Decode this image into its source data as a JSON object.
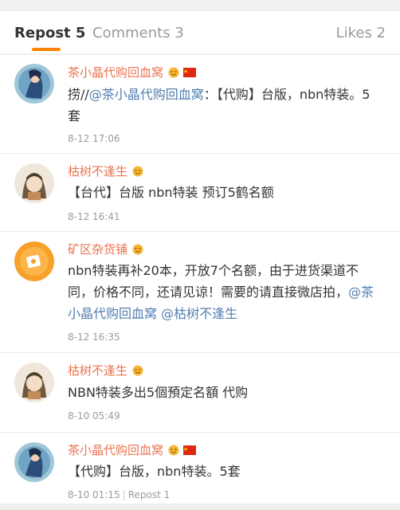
{
  "tabs": {
    "repost": "Repost 5",
    "comments": "Comments 3",
    "likes": "Likes 2"
  },
  "colors": {
    "accent": "#ff8200",
    "username": "#eb7350",
    "mention": "#507daf"
  },
  "items": [
    {
      "user": "茶小晶代购回血窝",
      "badges": [
        "vip-face-icon",
        "china-flag-icon"
      ],
      "text_parts": [
        "捞//",
        "@茶小晶代购回血窝",
        "：【代购】台版，nbn特装。5套"
      ],
      "time": "8-12 17:06"
    },
    {
      "user": "枯树不逢生",
      "badges": [
        "vip-face-icon"
      ],
      "text": "【台代】台版 nbn特装 预订5鹤名额",
      "time": "8-12 16:41"
    },
    {
      "user": "矿区杂货铺",
      "badges": [
        "vip-face-icon"
      ],
      "text_parts": [
        "nbn特装再补20本，开放7个名额，由于进货渠道不同，价格不同，还请见谅！需要的请直接微店拍，",
        "@茶小晶代购回血窝",
        " ",
        "@枯树不逢生"
      ],
      "time": "8-12 16:35"
    },
    {
      "user": "枯树不逢生",
      "badges": [
        "vip-face-icon"
      ],
      "text": "NBN特装多出5個預定名額  代购",
      "time": "8-10 05:49"
    },
    {
      "user": "茶小晶代购回血窝",
      "badges": [
        "vip-face-icon",
        "china-flag-icon"
      ],
      "text": "【代购】台版，nbn特装。5套",
      "time": "8-10 01:15",
      "extra": "Repost 1"
    }
  ]
}
